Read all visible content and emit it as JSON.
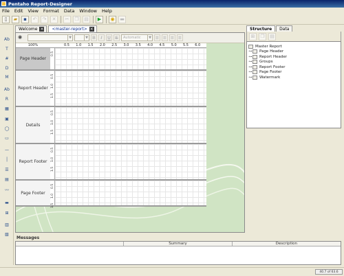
{
  "window": {
    "title": "Pentaho Report-Designer"
  },
  "menu": [
    "File",
    "Edit",
    "View",
    "Format",
    "Data",
    "Window",
    "Help"
  ],
  "toolbar": {
    "icons": [
      "new-report-icon",
      "open-icon",
      "save-icon",
      "undo-icon",
      "redo-icon",
      "delete-icon",
      "cut-icon",
      "copy-icon",
      "paste-icon",
      "run-preview-icon",
      "publish-icon",
      "deploy-icon"
    ],
    "run_glyph": "▶"
  },
  "palette": {
    "items": [
      {
        "name": "label-icon",
        "glyph": "Ab"
      },
      {
        "name": "text-field-icon",
        "glyph": "T"
      },
      {
        "name": "number-field-icon",
        "glyph": "#"
      },
      {
        "name": "date-field-icon",
        "glyph": "D"
      },
      {
        "name": "message-field-icon",
        "glyph": "M"
      },
      {
        "name": "resource-label-icon",
        "glyph": "Ab"
      },
      {
        "name": "resource-field-icon",
        "glyph": "R"
      },
      {
        "name": "image-field-icon",
        "glyph": "▦"
      },
      {
        "name": "image-icon",
        "glyph": "▣"
      },
      {
        "name": "ellipse-icon",
        "glyph": "◯"
      },
      {
        "name": "rectangle-icon",
        "glyph": "▭"
      },
      {
        "name": "horizontal-line-icon",
        "glyph": "—"
      },
      {
        "name": "vertical-line-icon",
        "glyph": "│"
      },
      {
        "name": "survey-scale-icon",
        "glyph": "☰"
      },
      {
        "name": "chart-icon",
        "glyph": "▤"
      },
      {
        "name": "sparkline-icon",
        "glyph": "〰"
      },
      {
        "name": "band-icon",
        "glyph": "▬"
      },
      {
        "name": "subreport-icon",
        "glyph": "⊞"
      },
      {
        "name": "table-of-contents-icon",
        "glyph": "▥"
      },
      {
        "name": "index-icon",
        "glyph": "▧"
      }
    ]
  },
  "tabs": [
    {
      "label": "Welcome"
    },
    {
      "label": "<master-report>"
    }
  ],
  "format_bar": {
    "font_combo": "",
    "size_combo": "",
    "bold": "B",
    "italic": "I",
    "underline": "U",
    "strikethrough": "S",
    "autosize_combo": "Automatic"
  },
  "report_canvas": {
    "zoom": "100%",
    "ruler_labels": [
      "0.5",
      "1.0",
      "1.5",
      "2.0",
      "2.5",
      "3.0",
      "3.5",
      "4.0",
      "4.5",
      "5.0",
      "5.5",
      "6.0"
    ],
    "bands": [
      {
        "label": "Page Header",
        "ruler": [
          "0.5"
        ],
        "selected": true
      },
      {
        "label": "Report Header",
        "ruler": [
          "0.5",
          "1.0",
          "1.5"
        ],
        "selected": false
      },
      {
        "label": "Details",
        "ruler": [
          "0.5",
          "1.0",
          "1.5"
        ],
        "selected": false
      },
      {
        "label": "Report Footer",
        "ruler": [
          "0.5",
          "1.0",
          "1.5"
        ],
        "selected": false
      },
      {
        "label": "Page Footer",
        "ruler": [
          "0.5",
          "1.0",
          "1.5"
        ],
        "selected": false
      }
    ]
  },
  "structure_panel": {
    "tabs": [
      "Structure",
      "Data"
    ],
    "tree": [
      {
        "label": "Master Report",
        "level": 0
      },
      {
        "label": "Page Header",
        "level": 1
      },
      {
        "label": "Report Header",
        "level": 1
      },
      {
        "label": "Groups",
        "level": 1
      },
      {
        "label": "Report Footer",
        "level": 1
      },
      {
        "label": "Page Footer",
        "level": 1
      },
      {
        "label": "Watermark",
        "level": 1
      }
    ]
  },
  "messages": {
    "title": "Messages",
    "columns": [
      "",
      "Summary",
      "Description"
    ]
  },
  "status": {
    "memory": "40.7 of 63.6"
  }
}
